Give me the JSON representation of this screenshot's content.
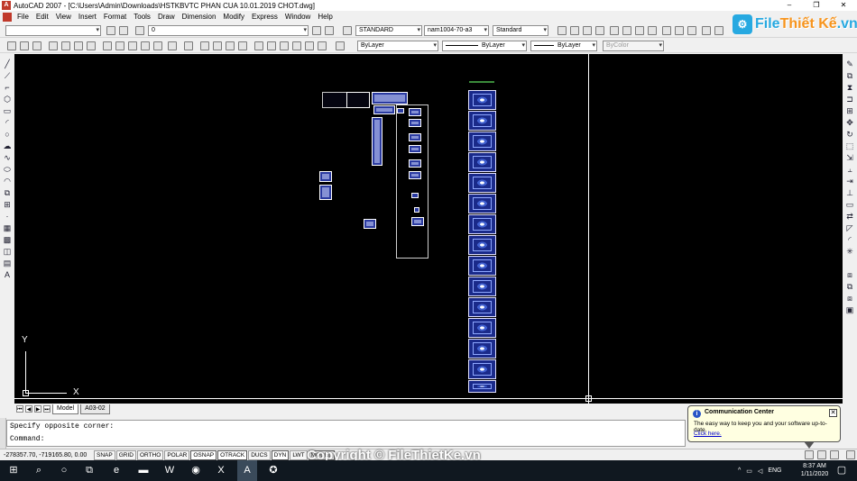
{
  "window": {
    "title": "AutoCAD 2007 - [C:\\Users\\Admin\\Downloads\\HSTKBVTC PHAN CUA 10.01.2019 CHOT.dwg]",
    "minimize": "–",
    "restore": "❐",
    "close": "✕"
  },
  "menu": [
    "File",
    "Edit",
    "View",
    "Insert",
    "Format",
    "Tools",
    "Draw",
    "Dimension",
    "Modify",
    "Express",
    "Window",
    "Help"
  ],
  "toolbar": {
    "workspace_select": "",
    "layer_select": "0",
    "text_style": "STANDARD",
    "dim_style": "nam1004-70-a3",
    "table_style": "Standard",
    "color_select": "ByLayer",
    "linetype_select": "ByLayer",
    "lineweight_select": "ByLayer",
    "plotstyle_select": "ByColor"
  },
  "logo": {
    "brand_main": "File",
    "brand_accent": "Thiết Kế",
    "brand_suffix": ".vn"
  },
  "ucs": {
    "y_label": "Y",
    "x_label": "X"
  },
  "layout_tabs": [
    {
      "label": "Model",
      "active": true
    },
    {
      "label": "A03-02",
      "active": false
    }
  ],
  "command_window": {
    "history_line": "Specify opposite corner:",
    "prompt": "Command:"
  },
  "status_bar": {
    "coordinates": "-278357.70, -719165.80, 0.00",
    "buttons": [
      "SNAP",
      "GRID",
      "ORTHO",
      "POLAR",
      "OSNAP",
      "OTRACK",
      "DUCS",
      "DYN",
      "LWT",
      "MODEL"
    ],
    "on_buttons": [
      "OSNAP",
      "OTRACK",
      "DYN",
      "MODEL"
    ]
  },
  "watermark": "Copyright © FileThietKe.vn",
  "balloon": {
    "title": "Communication Center",
    "body": "The easy way to keep you and your software up-to-date.",
    "link": "Click here.",
    "close": "✕"
  },
  "taskbar": {
    "tray_language": "ENG",
    "time": "8:37 AM",
    "date": "1/11/2020"
  },
  "colors": {
    "canvas": "#000000",
    "taskbar": "#101820",
    "balloon": "#ffffe1",
    "logo_blue": "#27a9e1",
    "logo_orange": "#f7941d"
  }
}
